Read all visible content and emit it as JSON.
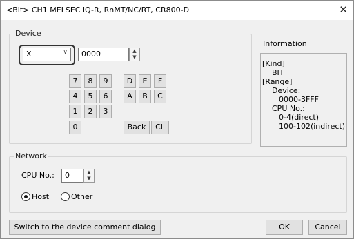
{
  "window": {
    "title": "<Bit> CH1 MELSEC iQ-R, RnMT/NC/RT, CR800-D",
    "close_icon": "close-icon"
  },
  "device": {
    "group_label": "Device",
    "type_value": "X",
    "address_value": "0000",
    "keypad": {
      "row1": [
        "7",
        "8",
        "9",
        "D",
        "E",
        "F"
      ],
      "row2": [
        "4",
        "5",
        "6",
        "A",
        "B",
        "C"
      ],
      "row3": [
        "1",
        "2",
        "3"
      ],
      "row4": [
        "0",
        "Back",
        "CL"
      ]
    }
  },
  "information": {
    "title": "Information",
    "lines": [
      "[Kind]",
      "BIT",
      "[Range]",
      "Device:",
      "0000-3FFF",
      "CPU No.:",
      "0-4(direct)",
      "100-102(indirect)"
    ]
  },
  "network": {
    "group_label": "Network",
    "cpu_label": "CPU No.:",
    "cpu_value": "0",
    "host_label": "Host",
    "other_label": "Other",
    "selected": "Host"
  },
  "footer": {
    "switch_label": "Switch to the device comment dialog",
    "ok_label": "OK",
    "cancel_label": "Cancel"
  }
}
